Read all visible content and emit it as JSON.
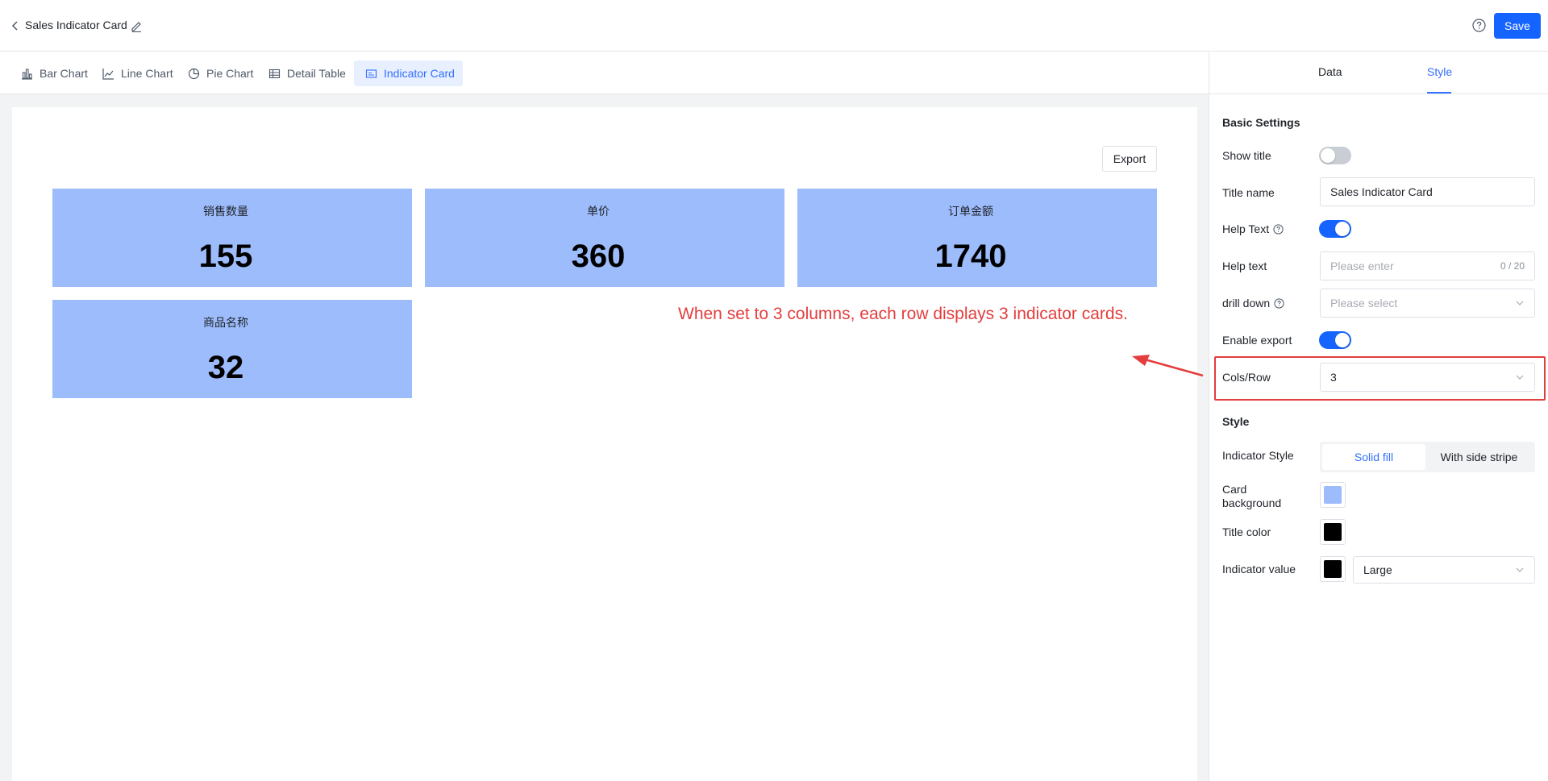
{
  "header": {
    "title": "Sales Indicator Card",
    "save_label": "Save"
  },
  "chart_tabs": [
    {
      "label": "Bar Chart",
      "icon": "bar-chart-icon"
    },
    {
      "label": "Line Chart",
      "icon": "line-chart-icon"
    },
    {
      "label": "Pie Chart",
      "icon": "pie-chart-icon"
    },
    {
      "label": "Detail Table",
      "icon": "table-icon"
    },
    {
      "label": "Indicator Card",
      "icon": "indicator-card-icon",
      "active": true
    }
  ],
  "canvas": {
    "export_label": "Export",
    "cards": [
      {
        "title": "销售数量",
        "value": "155"
      },
      {
        "title": "单价",
        "value": "360"
      },
      {
        "title": "订单金额",
        "value": "1740"
      },
      {
        "title": "商品名称",
        "value": "32"
      }
    ],
    "annotation": "When set to 3 columns, each row displays 3 indicator cards."
  },
  "panel": {
    "tabs": {
      "data": "Data",
      "style": "Style",
      "active": "Style"
    },
    "basic": {
      "section_title": "Basic Settings",
      "show_title_label": "Show title",
      "show_title_on": false,
      "title_name_label": "Title name",
      "title_name_value": "Sales Indicator Card",
      "help_text_toggle_label": "Help Text",
      "help_text_toggle_on": true,
      "help_text_label": "Help text",
      "help_text_placeholder": "Please enter",
      "help_text_counter": "0 / 20",
      "drill_down_label": "drill down",
      "drill_down_placeholder": "Please select",
      "enable_export_label": "Enable export",
      "enable_export_on": true,
      "cols_row_label": "Cols/Row",
      "cols_row_value": "3"
    },
    "style": {
      "section_title": "Style",
      "indicator_style_label": "Indicator Style",
      "indicator_style_options": [
        "Solid fill",
        "With side stripe"
      ],
      "indicator_style_selected": "Solid fill",
      "card_background_label": "Card background",
      "card_background_color": "#9dbcfc",
      "title_color_label": "Title color",
      "title_color": "#000000",
      "indicator_value_label": "Indicator value",
      "indicator_value_color": "#000000",
      "indicator_value_size": "Large"
    }
  },
  "colors": {
    "accent": "#1664ff",
    "card_fill": "#9dbcfc",
    "annotation": "#e43d3d"
  }
}
